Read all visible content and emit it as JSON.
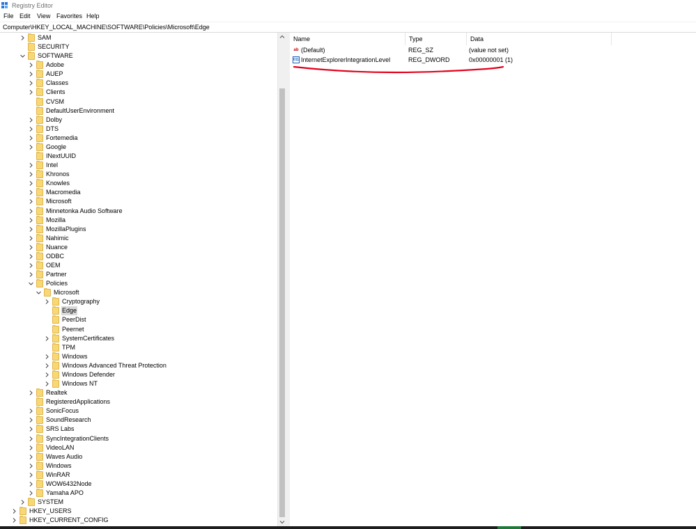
{
  "window": {
    "title": "Registry Editor"
  },
  "menu": [
    "File",
    "Edit",
    "View",
    "Favorites",
    "Help"
  ],
  "address": "Computer\\HKEY_LOCAL_MACHINE\\SOFTWARE\\Policies\\Microsoft\\Edge",
  "tree": [
    {
      "label": "SAM",
      "level": 2,
      "chevron": "right"
    },
    {
      "label": "SECURITY",
      "level": 2,
      "chevron": "none"
    },
    {
      "label": "SOFTWARE",
      "level": 2,
      "chevron": "down"
    },
    {
      "label": "Adobe",
      "level": 3,
      "chevron": "right"
    },
    {
      "label": "AUEP",
      "level": 3,
      "chevron": "right"
    },
    {
      "label": "Classes",
      "level": 3,
      "chevron": "right"
    },
    {
      "label": "Clients",
      "level": 3,
      "chevron": "right"
    },
    {
      "label": "CVSM",
      "level": 3,
      "chevron": "none"
    },
    {
      "label": "DefaultUserEnvironment",
      "level": 3,
      "chevron": "none"
    },
    {
      "label": "Dolby",
      "level": 3,
      "chevron": "right"
    },
    {
      "label": "DTS",
      "level": 3,
      "chevron": "right"
    },
    {
      "label": "Fortemedia",
      "level": 3,
      "chevron": "right"
    },
    {
      "label": "Google",
      "level": 3,
      "chevron": "right"
    },
    {
      "label": "INextUUID",
      "level": 3,
      "chevron": "none"
    },
    {
      "label": "Intel",
      "level": 3,
      "chevron": "right"
    },
    {
      "label": "Khronos",
      "level": 3,
      "chevron": "right"
    },
    {
      "label": "Knowles",
      "level": 3,
      "chevron": "right"
    },
    {
      "label": "Macromedia",
      "level": 3,
      "chevron": "right"
    },
    {
      "label": "Microsoft",
      "level": 3,
      "chevron": "right"
    },
    {
      "label": "Minnetonka Audio Software",
      "level": 3,
      "chevron": "right"
    },
    {
      "label": "Mozilla",
      "level": 3,
      "chevron": "right"
    },
    {
      "label": "MozillaPlugins",
      "level": 3,
      "chevron": "right"
    },
    {
      "label": "Nahimic",
      "level": 3,
      "chevron": "right"
    },
    {
      "label": "Nuance",
      "level": 3,
      "chevron": "right"
    },
    {
      "label": "ODBC",
      "level": 3,
      "chevron": "right"
    },
    {
      "label": "OEM",
      "level": 3,
      "chevron": "right"
    },
    {
      "label": "Partner",
      "level": 3,
      "chevron": "right"
    },
    {
      "label": "Policies",
      "level": 3,
      "chevron": "down"
    },
    {
      "label": "Microsoft",
      "level": 4,
      "chevron": "down"
    },
    {
      "label": "Cryptography",
      "level": 5,
      "chevron": "right"
    },
    {
      "label": "Edge",
      "level": 5,
      "chevron": "none",
      "selected": true
    },
    {
      "label": "PeerDist",
      "level": 5,
      "chevron": "none"
    },
    {
      "label": "Peernet",
      "level": 5,
      "chevron": "none"
    },
    {
      "label": "SystemCertificates",
      "level": 5,
      "chevron": "right"
    },
    {
      "label": "TPM",
      "level": 5,
      "chevron": "none"
    },
    {
      "label": "Windows",
      "level": 5,
      "chevron": "right"
    },
    {
      "label": "Windows Advanced Threat Protection",
      "level": 5,
      "chevron": "right"
    },
    {
      "label": "Windows Defender",
      "level": 5,
      "chevron": "right"
    },
    {
      "label": "Windows NT",
      "level": 5,
      "chevron": "right"
    },
    {
      "label": "Realtek",
      "level": 3,
      "chevron": "right"
    },
    {
      "label": "RegisteredApplications",
      "level": 3,
      "chevron": "none"
    },
    {
      "label": "SonicFocus",
      "level": 3,
      "chevron": "right"
    },
    {
      "label": "SoundResearch",
      "level": 3,
      "chevron": "right"
    },
    {
      "label": "SRS Labs",
      "level": 3,
      "chevron": "right"
    },
    {
      "label": "SyncIntegrationClients",
      "level": 3,
      "chevron": "right"
    },
    {
      "label": "VideoLAN",
      "level": 3,
      "chevron": "right"
    },
    {
      "label": "Waves Audio",
      "level": 3,
      "chevron": "right"
    },
    {
      "label": "Windows",
      "level": 3,
      "chevron": "right"
    },
    {
      "label": "WinRAR",
      "level": 3,
      "chevron": "right"
    },
    {
      "label": "WOW6432Node",
      "level": 3,
      "chevron": "right"
    },
    {
      "label": "Yamaha APO",
      "level": 3,
      "chevron": "right"
    },
    {
      "label": "SYSTEM",
      "level": 2,
      "chevron": "right"
    },
    {
      "label": "HKEY_USERS",
      "level": 1,
      "chevron": "right"
    },
    {
      "label": "HKEY_CURRENT_CONFIG",
      "level": 1,
      "chevron": "right"
    }
  ],
  "list": {
    "columns": [
      "Name",
      "Type",
      "Data"
    ],
    "rows": [
      {
        "icon": "string-value-icon",
        "icon_text": "ab",
        "name": "(Default)",
        "type": "REG_SZ",
        "data": "(value not set)"
      },
      {
        "icon": "binary-value-icon",
        "icon_text": "011",
        "name": "InternetExplorerIntegrationLevel",
        "type": "REG_DWORD",
        "data": "0x00000001 (1)"
      }
    ]
  },
  "annotation_color": "#e3001b"
}
